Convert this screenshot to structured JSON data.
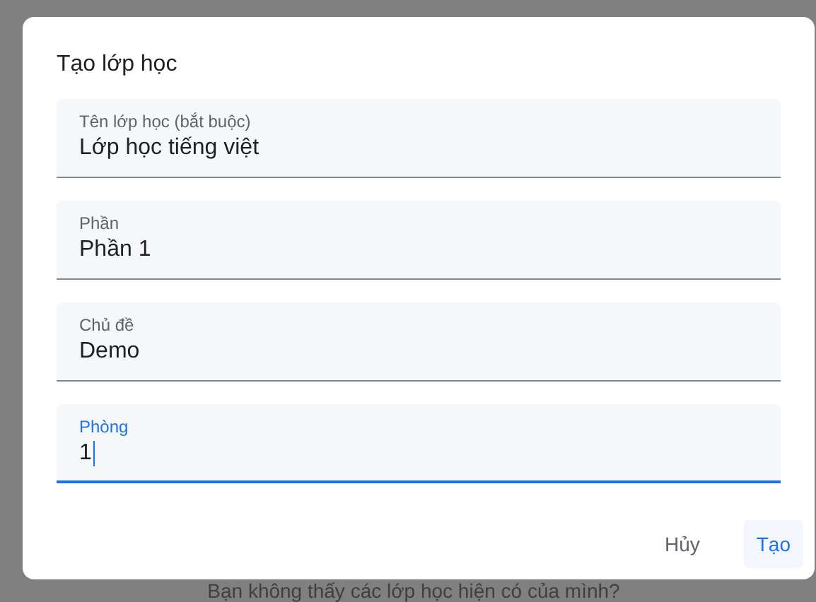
{
  "dialog": {
    "title": "Tạo lớp học",
    "fields": [
      {
        "label": "Tên lớp học (bắt buộc)",
        "value": "Lớp học tiếng việt",
        "focused": false
      },
      {
        "label": "Phần",
        "value": "Phần 1",
        "focused": false
      },
      {
        "label": "Chủ đề",
        "value": "Demo",
        "focused": false
      },
      {
        "label": "Phòng",
        "value": "1",
        "focused": true
      }
    ],
    "buttons": [
      {
        "label": "Hủy",
        "kind": "text"
      },
      {
        "label": "Tạo",
        "kind": "tonal"
      }
    ]
  },
  "background_text": "Bạn không thấy các lớp học hiện có của mình?"
}
